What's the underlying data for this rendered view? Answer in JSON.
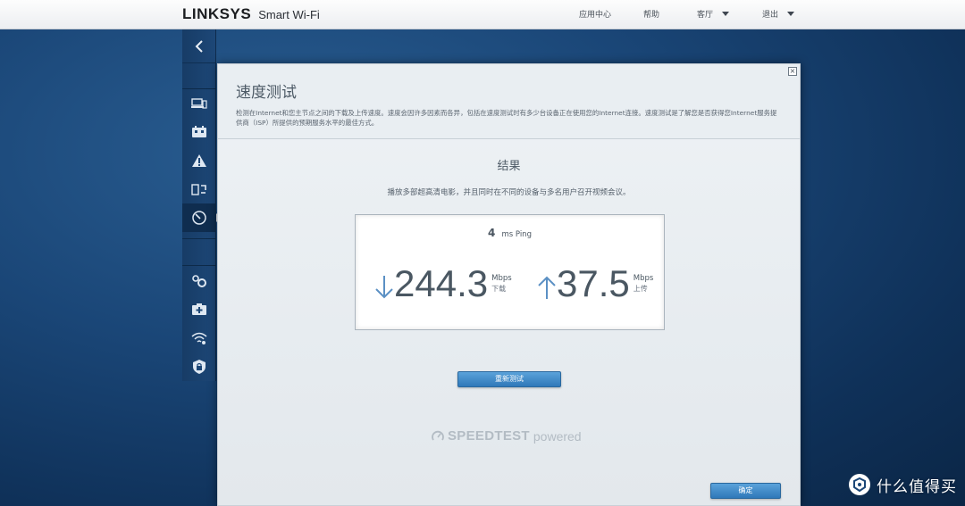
{
  "header": {
    "brand": "LINKSYS",
    "product": "Smart Wi-Fi",
    "nav": [
      {
        "label": "应用中心",
        "has_dropdown": false
      },
      {
        "label": "帮助",
        "has_dropdown": false
      },
      {
        "label": "客厅",
        "has_dropdown": true
      },
      {
        "label": "退出",
        "has_dropdown": true
      }
    ]
  },
  "sidebar": {
    "back_icon": "chevron-left-icon",
    "items": [
      {
        "icon": "devices-icon",
        "active": false
      },
      {
        "icon": "network-map-icon",
        "active": false
      },
      {
        "icon": "alert-icon",
        "active": false
      },
      {
        "icon": "media-prioritization-icon",
        "active": false
      },
      {
        "icon": "speed-test-icon",
        "active": true
      },
      {
        "icon": "settings-icon",
        "active": false
      },
      {
        "icon": "diagnostics-icon",
        "active": false
      },
      {
        "icon": "wireless-icon",
        "active": false
      },
      {
        "icon": "security-icon",
        "active": false
      }
    ]
  },
  "dialog": {
    "title": "速度测试",
    "description": "检测在Internet和您主节点之间的下载及上传速度。速度会因许多因素而各异，包括在速度测试时有多少台设备正在使用您的Internet连接。速度测试是了解您是否获得您Internet服务提供商（ISP）所提供的预期服务水平的最佳方式。",
    "close_label": "×",
    "result_title": "结果",
    "result_description": "播放多部超高清电影，并且同时在不同的设备与多名用户召开视频会议。",
    "ping": {
      "value": "4",
      "unit": "ms Ping"
    },
    "download": {
      "value": "244.3",
      "unit": "Mbps",
      "label": "下载"
    },
    "upload": {
      "value": "37.5",
      "unit": "Mbps",
      "label": "上传"
    },
    "retest_button": "重新测试",
    "speedtest_brand": "SPEEDTEST",
    "speedtest_suffix": "powered",
    "ok_button": "确定"
  },
  "watermark": {
    "text": "什么值得买"
  },
  "colors": {
    "background": "#1a4677",
    "sidebar": "#1d4777",
    "button_blue": "#3a86c6",
    "dialog_bg": "#eaeef2",
    "text_gray": "#4d5a66"
  }
}
